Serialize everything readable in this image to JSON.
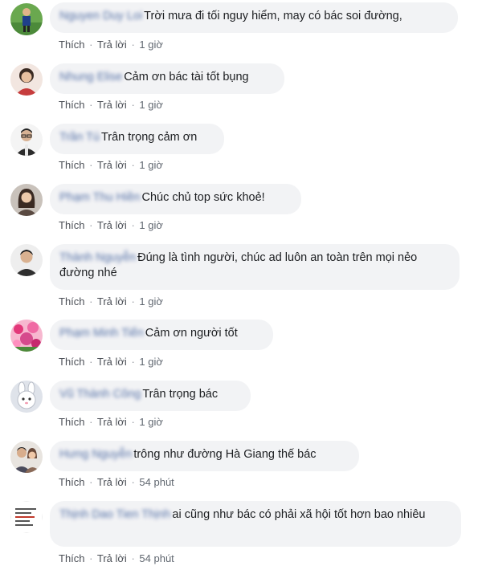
{
  "comments": [
    {
      "author": "Nguyen Duy Loi",
      "text": "Trời mưa đi tối nguy hiểm, may có bác soi đường,",
      "like_label": "Thích",
      "reply_label": "Trả lời",
      "separator": "·",
      "time": "1 giờ",
      "avatar_icon": "avatar-football-player",
      "avatar_color": "#4c8a3a"
    },
    {
      "author": "Nhung Elise",
      "text": "Cảm ơn bác tài tốt bụng",
      "like_label": "Thích",
      "reply_label": "Trả lời",
      "separator": "·",
      "time": "1 giờ",
      "avatar_icon": "avatar-woman-red",
      "avatar_color": "#c63d3d"
    },
    {
      "author": "Trần Tú",
      "text": "Trân trọng cảm ơn",
      "like_label": "Thích",
      "reply_label": "Trả lời",
      "separator": "·",
      "time": "1 giờ",
      "avatar_icon": "avatar-man-glasses",
      "avatar_color": "#3a3a3a"
    },
    {
      "author": "Phạm Thu Hiền",
      "text": "Chúc chủ top sức khoẻ!",
      "like_label": "Thích",
      "reply_label": "Trả lời",
      "separator": "·",
      "time": "1 giờ",
      "avatar_icon": "avatar-woman-dark-hair",
      "avatar_color": "#5a4a42"
    },
    {
      "author": "Thành Nguyễn",
      "text": "Đúng là tình người, chúc ad luôn an toàn trên mọi nẻo đường nhé",
      "like_label": "Thích",
      "reply_label": "Trả lời",
      "separator": "·",
      "time": "1 giờ",
      "avatar_icon": "avatar-man",
      "avatar_color": "#2f2f2f"
    },
    {
      "author": "Phạm Minh Tiến",
      "text": "Cảm ơn người tốt",
      "like_label": "Thích",
      "reply_label": "Trả lời",
      "separator": "·",
      "time": "1 giờ",
      "avatar_icon": "avatar-flowers",
      "avatar_color": "#d64a8c"
    },
    {
      "author": "Vũ Thành Công",
      "text": "Trân trọng bác",
      "like_label": "Thích",
      "reply_label": "Trả lời",
      "separator": "·",
      "time": "1 giờ",
      "avatar_icon": "avatar-cartoon-bunny",
      "avatar_color": "#c9cdd6"
    },
    {
      "author": "Hưng Nguyễn",
      "text": "trông như đường Hà Giang thế bác",
      "like_label": "Thích",
      "reply_label": "Trả lời",
      "separator": "·",
      "time": "54 phút",
      "avatar_icon": "avatar-couple",
      "avatar_color": "#8a6a58"
    },
    {
      "author": "Thịnh Dao Tien Thịnh",
      "text": "ai cũng như bác có phải xã hội tốt hơn bao nhiêu",
      "like_label": "Thích",
      "reply_label": "Trả lời",
      "separator": "·",
      "time": "54 phút",
      "avatar_icon": "avatar-text-quote",
      "avatar_color": "#ffffff"
    }
  ]
}
